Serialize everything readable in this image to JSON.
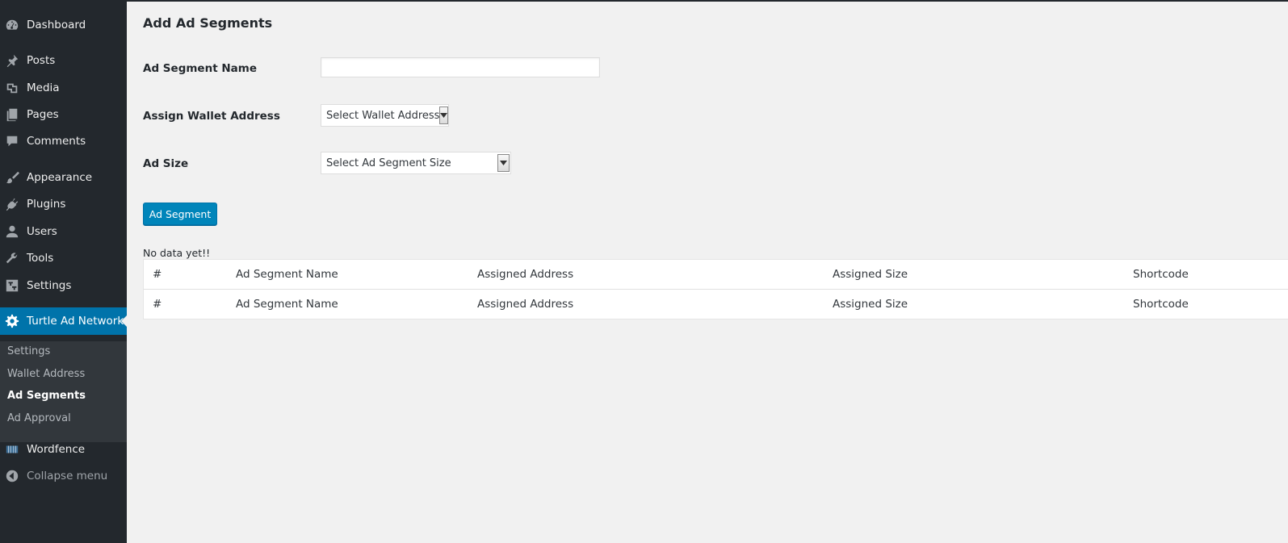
{
  "sidebar": {
    "items": [
      {
        "label": "Dashboard",
        "icon": "dashboard-icon"
      },
      {
        "label": "Posts",
        "icon": "pin-icon"
      },
      {
        "label": "Media",
        "icon": "media-icon"
      },
      {
        "label": "Pages",
        "icon": "pages-icon"
      },
      {
        "label": "Comments",
        "icon": "comment-icon"
      },
      {
        "label": "Appearance",
        "icon": "paintbrush-icon"
      },
      {
        "label": "Plugins",
        "icon": "plugin-icon"
      },
      {
        "label": "Users",
        "icon": "user-icon"
      },
      {
        "label": "Tools",
        "icon": "wrench-icon"
      },
      {
        "label": "Settings",
        "icon": "settings-icon"
      },
      {
        "label": "Turtle Ad Network",
        "icon": "gear-icon"
      },
      {
        "label": "Wordfence",
        "icon": "wordfence-icon"
      },
      {
        "label": "Collapse menu",
        "icon": "collapse-icon"
      }
    ],
    "submenu": [
      "Settings",
      "Wallet Address",
      "Ad Segments",
      "Ad Approval"
    ],
    "active": "Turtle Ad Network",
    "current_sub": "Ad Segments"
  },
  "page": {
    "title": "Add Ad Segments",
    "form": {
      "name_label": "Ad Segment Name",
      "name_value": "",
      "wallet_label": "Assign Wallet Address",
      "wallet_selected": "Select Wallet Address",
      "size_label": "Ad Size",
      "size_selected": "Select Ad Segment Size",
      "submit_label": "Ad Segment"
    },
    "empty_message": "No data yet!!",
    "table": {
      "columns": [
        "#",
        "Ad Segment Name",
        "Assigned Address",
        "Assigned Size",
        "Shortcode"
      ],
      "footer": [
        "#",
        "Ad Segment Name",
        "Assigned Address",
        "Assigned Size",
        "Shortcode"
      ]
    }
  },
  "colors": {
    "sidebar_bg": "#23282d",
    "submenu_bg": "#32373c",
    "accent": "#0073aa",
    "button": "#0085ba",
    "page_bg": "#f1f1f1"
  }
}
